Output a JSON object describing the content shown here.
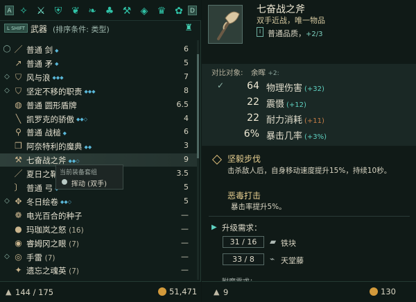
{
  "category_bar": {
    "prev_key": "A",
    "next_key": "D",
    "icons": [
      "all-items-icon",
      "weapons-icon",
      "armor-icon",
      "potions-icon",
      "scrolls-icon",
      "books-icon",
      "anvil-icon",
      "gems-icon",
      "crown-icon",
      "misc-icon"
    ]
  },
  "sort": {
    "shift_key": "L SHIFT",
    "category_label": "武器",
    "condition": "(排序条件: 类型)"
  },
  "items": [
    {
      "name": "普通 剑",
      "marks": "◆",
      "value": "6",
      "icon": "sword-icon",
      "lead_icon": "unequipped-icon"
    },
    {
      "name": "普通 矛",
      "marks": "◆",
      "value": "5",
      "icon": "spear-icon",
      "lead_icon": ""
    },
    {
      "name": "风与浪",
      "marks": "◆◆◆",
      "value": "7",
      "icon": "shield-icon",
      "lead_icon": "equipped-icon"
    },
    {
      "name": "坚定不移的职责",
      "marks": "◆◆◆",
      "value": "8",
      "icon": "shield-icon",
      "lead_icon": "equipped-icon"
    },
    {
      "name": "普通 圆形盾牌",
      "marks": "",
      "value": "6.5",
      "icon": "round-shield-icon",
      "lead_icon": ""
    },
    {
      "name": "凯罗克的骄傲",
      "marks": "◆◆◇",
      "value": "4",
      "icon": "staff-icon",
      "lead_icon": ""
    },
    {
      "name": "普通 战槌",
      "marks": "◆",
      "value": "6",
      "icon": "mace-icon",
      "lead_icon": ""
    },
    {
      "name": "阿奈特利的魔典",
      "marks": "◆◆",
      "value": "3",
      "icon": "tome-icon",
      "lead_icon": ""
    },
    {
      "name": "七奋战之斧",
      "marks": "◆◆◇",
      "value": "9",
      "icon": "axe-icon",
      "lead_icon": ""
    },
    {
      "name": "夏日之鞘",
      "marks": "",
      "value": "3.5",
      "icon": "sword-icon",
      "lead_icon": ""
    },
    {
      "name": "普通 弓",
      "marks": "◆",
      "value": "5",
      "icon": "bow-icon",
      "lead_icon": ""
    },
    {
      "name": "冬日绘卷",
      "marks": "◆◆◇",
      "value": "5",
      "icon": "scroll-icon",
      "lead_icon": "equipped-icon"
    },
    {
      "name": "电光百合的种子",
      "count": "",
      "marks": "",
      "value": "—",
      "icon": "seed-icon",
      "lead_icon": ""
    },
    {
      "name": "玛珈岚之怒",
      "count": "(16)",
      "marks": "",
      "value": "—",
      "icon": "bomb-icon",
      "lead_icon": ""
    },
    {
      "name": "睿姆冈之眼",
      "count": "(7)",
      "marks": "",
      "value": "—",
      "icon": "eye-icon",
      "lead_icon": ""
    },
    {
      "name": "手雷",
      "count": "(7)",
      "marks": "",
      "value": "—",
      "icon": "grenade-icon",
      "lead_icon": "equipped-icon"
    },
    {
      "name": "遗忘之魂英",
      "count": "(7)",
      "marks": "",
      "value": "—",
      "icon": "soul-icon",
      "lead_icon": ""
    }
  ],
  "tooltip": {
    "title": "当前装备套组",
    "slot": "挥动 (双手)"
  },
  "left_footer": {
    "weight": "144 / 175",
    "gold": "51,471"
  },
  "detail": {
    "title": "七奋战之斧",
    "subtitle": "双手近战，唯一物品",
    "quality_badge": "I",
    "quality": "普通品质，",
    "quality_extra": "+2/3",
    "compare_label": "对比对象:",
    "compare_item": "余晖",
    "compare_level": "+2:",
    "stats": [
      {
        "check": "✓",
        "value": "64",
        "label": "物理伤害",
        "delta": "(+32)",
        "delta_class": "pos"
      },
      {
        "check": "",
        "value": "22",
        "label": "震慑",
        "delta": "(+12)",
        "delta_class": "pos"
      },
      {
        "check": "",
        "value": "22",
        "label": "耐力消耗",
        "delta": "(+11)",
        "delta_class": "neg"
      },
      {
        "check": "",
        "value": "6%",
        "label": "暴击几率",
        "delta": "(+3%)",
        "delta_class": "pos"
      }
    ],
    "trait1_title": "坚毅步伐",
    "trait1_desc": "击杀敌人后，自身移动速度提升15%，持续10秒。",
    "trait2_title": "恶毒打击",
    "trait2_desc": "暴击率提升5%。",
    "upgrade_title": "升级需求：",
    "materials": [
      {
        "amount": "31 / 16",
        "name": "铁块",
        "icon": "iron-icon"
      },
      {
        "amount": "33 / 8",
        "name": "天堂藤",
        "icon": "vine-icon"
      }
    ],
    "enchant_title": "附魔需求："
  },
  "right_footer": {
    "weight": "9",
    "gold": "130"
  }
}
